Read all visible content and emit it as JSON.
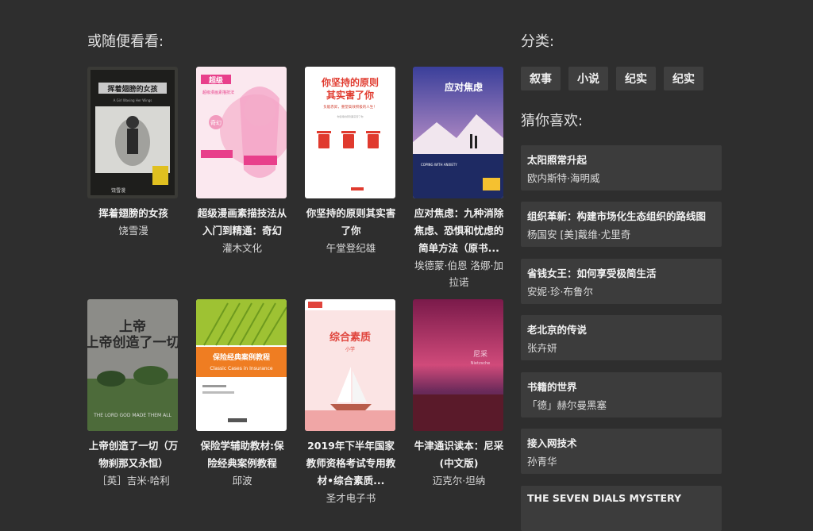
{
  "browse": {
    "title": "或随便看看:",
    "books": [
      {
        "title": "挥着翅膀的女孩",
        "author": "饶雪漫",
        "cover_title": "挥着翅膀的女孩",
        "cover_sub": "A Girl Waving Her Wings"
      },
      {
        "title": "超级漫画素描技法从入门到精通：奇幻",
        "author": "灌木文化",
        "cover_title": "超级漫画素描技法",
        "cover_sub": "奇幻"
      },
      {
        "title": "你坚持的原则其实害了你",
        "author": "午堂登纪雄",
        "cover_title": "你坚持的原则其实害了你",
        "cover_sub": "负能赤昇，重塑高效积极的人生！"
      },
      {
        "title": "应对焦虑：九种消除焦虑、恐惧和忧虑的简单方法（原书...",
        "author": "埃德蒙·伯恩 洛娜·加拉诺",
        "cover_title": "应对焦虑",
        "cover_sub": "COPING WITH ANXIETY"
      },
      {
        "title": "上帝创造了一切（万物刹那又永恒）",
        "author": "［英］吉米·哈利",
        "cover_title": "上帝创造了一切",
        "cover_sub": "THE LORD GOD MADE THEM ALL"
      },
      {
        "title": "保险学辅助教材:保险经典案例教程",
        "author": "邱波",
        "cover_title": "保险经典案例教程",
        "cover_sub": "Classic Cases in Insurance"
      },
      {
        "title": "2019年下半年国家教师资格考试专用教材•综合素质...",
        "author": "圣才电子书",
        "cover_title": "综合素质",
        "cover_sub": "小学"
      },
      {
        "title": "牛津通识读本：尼采(中文版)",
        "author": "迈克尔·坦纳",
        "cover_title": "尼采",
        "cover_sub": "Nietzsche"
      }
    ]
  },
  "categories": {
    "title": "分类:",
    "tags": [
      "叙事",
      "小说",
      "纪实",
      "纪实"
    ]
  },
  "guess": {
    "title": "猜你喜欢:",
    "items": [
      {
        "title": "太阳照常升起",
        "author": "欧内斯特·海明威"
      },
      {
        "title": "组织革新：构建市场化生态组织的路线图",
        "author": "杨国安 [美]戴维·尤里奇"
      },
      {
        "title": "省钱女王：如何享受极简生活",
        "author": "安妮·珍·布鲁尔"
      },
      {
        "title": "老北京的传说",
        "author": "张卉妍"
      },
      {
        "title": "书籍的世界",
        "author": "「德」赫尔曼黑塞"
      },
      {
        "title": "接入网技术",
        "author": "孙青华"
      },
      {
        "title": "THE SEVEN DIALS MYSTERY",
        "author": ""
      }
    ]
  }
}
